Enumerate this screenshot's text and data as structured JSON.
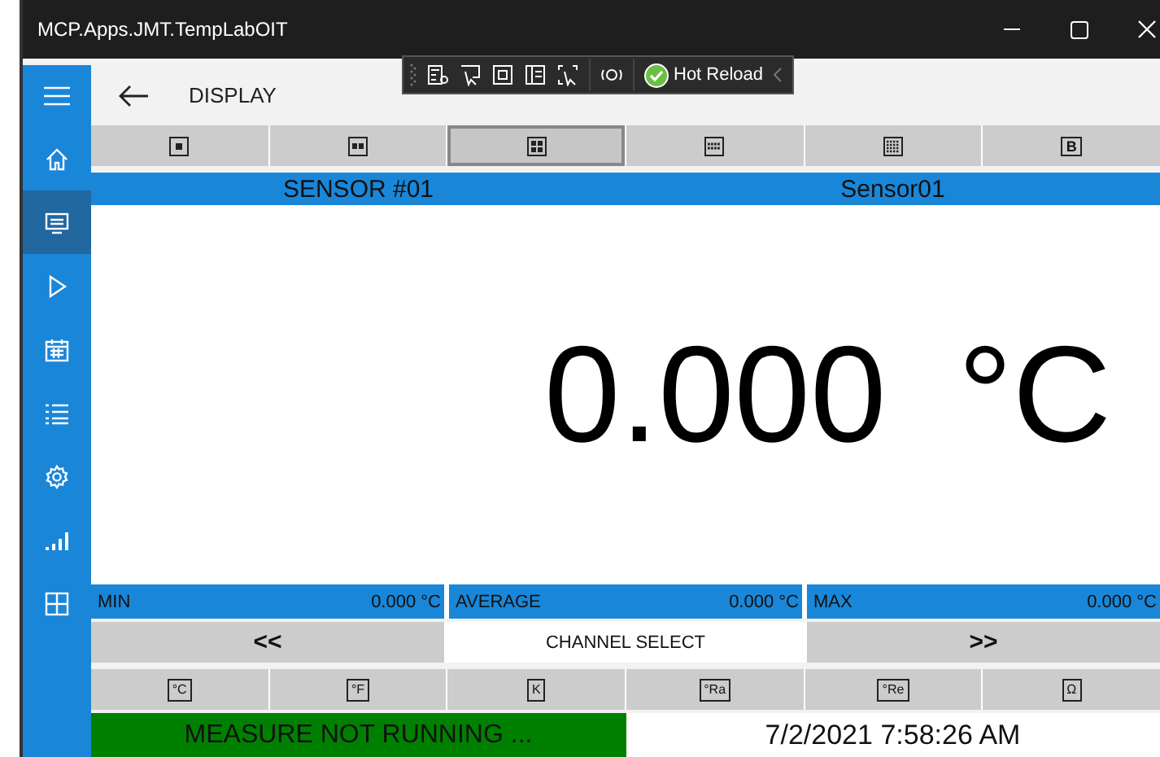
{
  "window": {
    "title": "MCP.Apps.JMT.TempLabOIT"
  },
  "debug_toolbar": {
    "label": "Hot Reload"
  },
  "sidebar": {
    "items": [
      {
        "kind": "home",
        "selected": false
      },
      {
        "kind": "monitor",
        "selected": true
      },
      {
        "kind": "play",
        "selected": false
      },
      {
        "kind": "calendar",
        "selected": false
      },
      {
        "kind": "list",
        "selected": false
      },
      {
        "kind": "gear",
        "selected": false
      },
      {
        "kind": "signal",
        "selected": false
      },
      {
        "kind": "grid",
        "selected": false
      }
    ]
  },
  "header": {
    "title": "DISPLAY"
  },
  "layout_buttons": [
    {
      "kind": "one",
      "selected": false
    },
    {
      "kind": "two",
      "selected": false
    },
    {
      "kind": "four",
      "selected": true
    },
    {
      "kind": "eight",
      "selected": false
    },
    {
      "kind": "many",
      "selected": false
    },
    {
      "kind": "text",
      "label": "B",
      "selected": false
    }
  ],
  "sensor_bar": {
    "channel": "SENSOR #01",
    "name": "Sensor01"
  },
  "reading": {
    "value": "0.000",
    "unit": "°C"
  },
  "stats": [
    {
      "label": "MIN",
      "value": "0.000 °C"
    },
    {
      "label": "AVERAGE",
      "value": "0.000 °C"
    },
    {
      "label": "MAX",
      "value": "0.000 °C"
    }
  ],
  "channel_select": {
    "previous": "<<",
    "label": "CHANNEL SELECT",
    "next": ">>"
  },
  "unit_buttons": [
    {
      "label": "°C"
    },
    {
      "label": "°F"
    },
    {
      "label": "K"
    },
    {
      "label": "°Ra"
    },
    {
      "label": "°Re"
    },
    {
      "label": "Ω"
    }
  ],
  "status": {
    "measure": "MEASURE NOT RUNNING ...",
    "datetime": "7/2/2021 7:58:26 AM"
  }
}
